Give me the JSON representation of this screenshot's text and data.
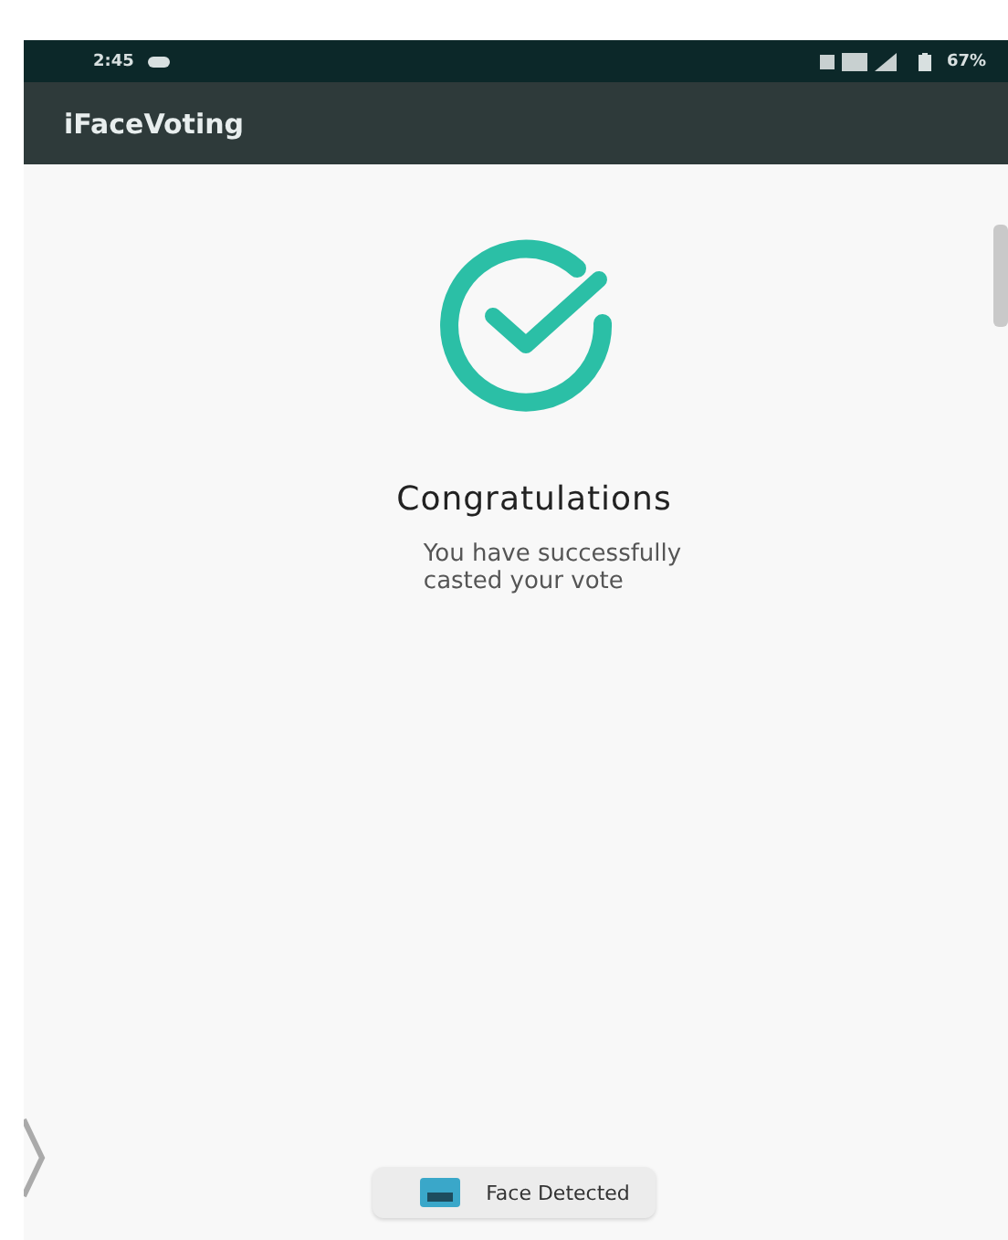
{
  "status_bar": {
    "time": "2:45",
    "battery": "67%"
  },
  "app_bar": {
    "title": "iFaceVoting"
  },
  "message": {
    "title": "Congratulations",
    "body": "You have successfully\ncasted your vote"
  },
  "toast": {
    "text": "Face Detected"
  }
}
